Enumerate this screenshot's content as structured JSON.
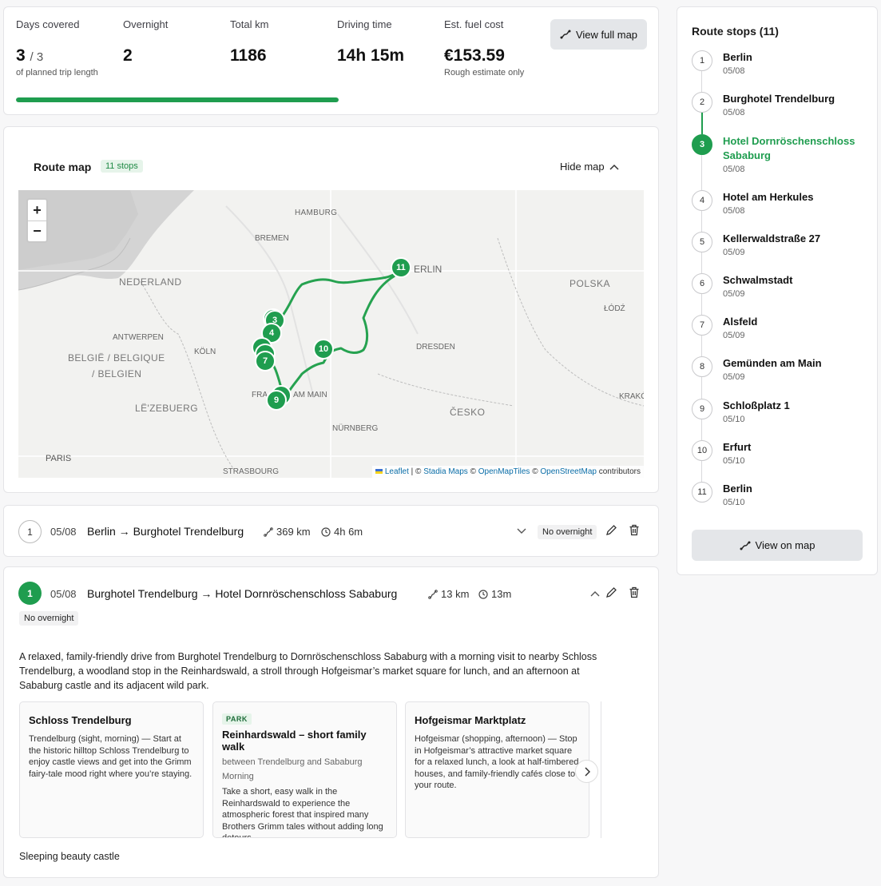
{
  "stats": {
    "days_label": "Days covered",
    "days_value": "3",
    "days_total": "/ 3",
    "days_note": "of planned trip length",
    "overnight_label": "Overnight",
    "overnight_value": "2",
    "km_label": "Total km",
    "km_value": "1186",
    "time_label": "Driving time",
    "time_value": "14h 15m",
    "fuel_label": "Est. fuel cost",
    "fuel_value": "€153.59",
    "fuel_note": "Rough estimate only",
    "view_full_map": "View full map",
    "progress": 1.0,
    "progress_color": "#1f9d4f"
  },
  "map": {
    "title": "Route map",
    "stops_badge": "11 stops",
    "hide_map": "Hide map",
    "zoom_in": "+",
    "zoom_out": "−",
    "labels": [
      "HAMBURG",
      "BREMEN",
      "NEDERLAND",
      "POLSKA",
      "ANTWERPEN",
      "BELGIË / BELGIQUE",
      "/ BELGIEN",
      "KÖLN",
      "DRESDEN",
      "ŁÓDŹ",
      "LË'ZEBUERG",
      "ČESKO",
      "NÜRNBERG",
      "KRAKÓ",
      "PARIS",
      "STRASBOURG",
      "ERLIN",
      "FRA",
      "AM MAIN"
    ],
    "markers": [
      "3",
      "4",
      "7",
      "9",
      "10",
      "11"
    ],
    "attribution": {
      "leaflet": "Leaflet",
      "sep1": " | © ",
      "stadia": "Stadia Maps",
      "sep2": " © ",
      "omt": "OpenMapTiles",
      "sep3": " © ",
      "osm": "OpenStreetMap",
      "tail": " contributors"
    }
  },
  "day1": {
    "num": "1",
    "date": "05/08",
    "route": "Berlin → Burghotel Trendelburg",
    "distance": "369 km",
    "duration": "4h 6m",
    "overnight": "No overnight"
  },
  "day2": {
    "num": "1",
    "date": "05/08",
    "route": "Burghotel Trendelburg → Hotel Dornröschenschloss Sababurg",
    "distance": "13 km",
    "duration": "13m",
    "overnight": "No overnight",
    "summary": "A relaxed, family-friendly drive from Burghotel Trendelburg to Dornröschenschloss Sababurg with a morning visit to nearby Schloss Trendelburg, a woodland stop in the Reinhardswald, a stroll through Hofgeismar’s market square for lunch, and an afternoon at Sababurg castle and its adjacent wild park.",
    "pois": [
      {
        "tag": "",
        "title": "Schloss Trendelburg",
        "sub": "",
        "time": "",
        "desc": "Trendelburg (sight, morning) — Start at the historic hilltop Schloss Trendelburg to enjoy castle views and get into the Grimm fairy-tale mood right where you’re staying."
      },
      {
        "tag": "PARK",
        "title": "Reinhardswald – short family walk",
        "sub": "between Trendelburg and Sababurg",
        "time": "Morning",
        "desc": "Take a short, easy walk in the Reinhardswald to experience the atmospheric forest that inspired many Brothers Grimm tales without adding long detours."
      },
      {
        "tag": "",
        "title": "Hofgeismar Marktplatz",
        "sub": "",
        "time": "",
        "desc": "Hofgeismar (shopping, afternoon) — Stop in Hofgeismar’s attractive market square for a relaxed lunch, a look at half-timbered houses, and family-friendly cafés close to your route."
      }
    ],
    "footnote": "Sleeping beauty castle"
  },
  "stops": {
    "title": "Route stops (11)",
    "view_on_map": "View on map",
    "active_index": 2,
    "items": [
      {
        "num": "1",
        "name": "Berlin",
        "date": "05/08"
      },
      {
        "num": "2",
        "name": "Burghotel Trendelburg",
        "date": "05/08"
      },
      {
        "num": "3",
        "name": "Hotel Dornröschenschloss Sababurg",
        "date": "05/08"
      },
      {
        "num": "4",
        "name": "Hotel am Herkules",
        "date": "05/08"
      },
      {
        "num": "5",
        "name": "Kellerwaldstraße 27",
        "date": "05/09"
      },
      {
        "num": "6",
        "name": "Schwalmstadt",
        "date": "05/09"
      },
      {
        "num": "7",
        "name": "Alsfeld",
        "date": "05/09"
      },
      {
        "num": "8",
        "name": "Gemünden am Main",
        "date": "05/09"
      },
      {
        "num": "9",
        "name": "Schloßplatz 1",
        "date": "05/10"
      },
      {
        "num": "10",
        "name": "Erfurt",
        "date": "05/10"
      },
      {
        "num": "11",
        "name": "Berlin",
        "date": "05/10"
      }
    ]
  }
}
